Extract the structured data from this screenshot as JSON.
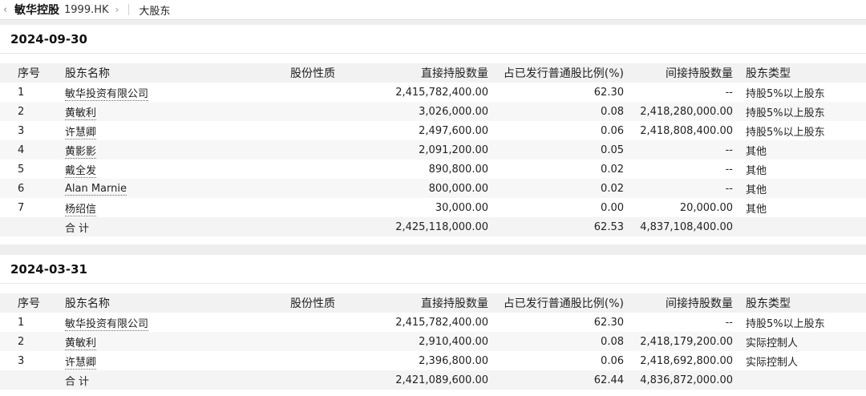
{
  "header": {
    "back_icon": "chevron-left-icon",
    "company": "敏华控股",
    "ticker": "1999.HK",
    "chevron_icon": "chevron-right-icon",
    "page": "大股东"
  },
  "columns": {
    "index": "序号",
    "name": "股东名称",
    "nature": "股份性质",
    "direct": "直接持股数量",
    "ratio": "占已发行普通股比例(%)",
    "indirect": "间接持股数量",
    "type": "股东类型"
  },
  "sections": [
    {
      "date": "2024-09-30",
      "rows": [
        {
          "index": "1",
          "name": "敏华投资有限公司",
          "nature": "",
          "direct": "2,415,782,400.00",
          "ratio": "62.30",
          "indirect": "--",
          "type": "持股5%以上股东"
        },
        {
          "index": "2",
          "name": "黄敏利",
          "nature": "",
          "direct": "3,026,000.00",
          "ratio": "0.08",
          "indirect": "2,418,280,000.00",
          "type": "持股5%以上股东"
        },
        {
          "index": "3",
          "name": "许慧卿",
          "nature": "",
          "direct": "2,497,600.00",
          "ratio": "0.06",
          "indirect": "2,418,808,400.00",
          "type": "持股5%以上股东"
        },
        {
          "index": "4",
          "name": "黄影影",
          "nature": "",
          "direct": "2,091,200.00",
          "ratio": "0.05",
          "indirect": "--",
          "type": "其他"
        },
        {
          "index": "5",
          "name": "戴全发",
          "nature": "",
          "direct": "890,800.00",
          "ratio": "0.02",
          "indirect": "--",
          "type": "其他"
        },
        {
          "index": "6",
          "name": "Alan Marnie",
          "nature": "",
          "direct": "800,000.00",
          "ratio": "0.02",
          "indirect": "--",
          "type": "其他"
        },
        {
          "index": "7",
          "name": "杨绍信",
          "nature": "",
          "direct": "30,000.00",
          "ratio": "0.00",
          "indirect": "20,000.00",
          "type": "其他"
        }
      ],
      "total": {
        "label": "合计",
        "direct": "2,425,118,000.00",
        "ratio": "62.53",
        "indirect": "4,837,108,400.00"
      }
    },
    {
      "date": "2024-03-31",
      "rows": [
        {
          "index": "1",
          "name": "敏华投资有限公司",
          "nature": "",
          "direct": "2,415,782,400.00",
          "ratio": "62.30",
          "indirect": "--",
          "type": "持股5%以上股东"
        },
        {
          "index": "2",
          "name": "黄敏利",
          "nature": "",
          "direct": "2,910,400.00",
          "ratio": "0.08",
          "indirect": "2,418,179,200.00",
          "type": "实际控制人"
        },
        {
          "index": "3",
          "name": "许慧卿",
          "nature": "",
          "direct": "2,396,800.00",
          "ratio": "0.06",
          "indirect": "2,418,692,800.00",
          "type": "实际控制人"
        }
      ],
      "total": {
        "label": "合计",
        "direct": "2,421,089,600.00",
        "ratio": "62.44",
        "indirect": "4,836,872,000.00"
      }
    }
  ]
}
